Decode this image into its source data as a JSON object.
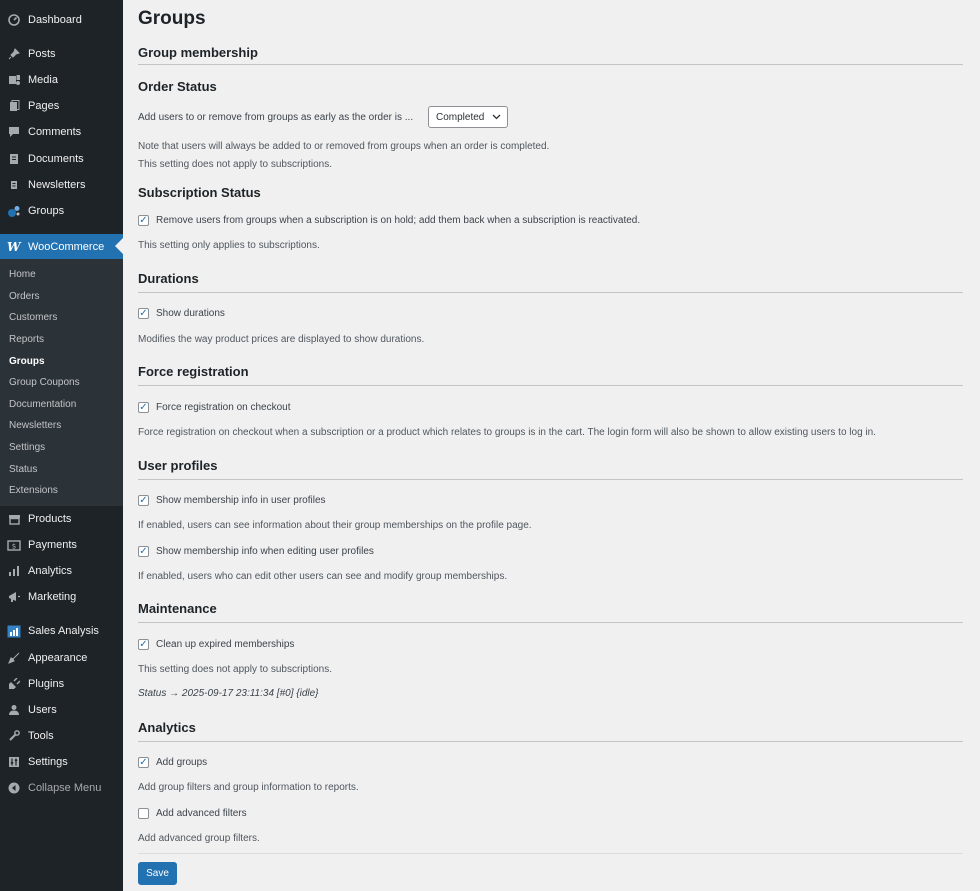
{
  "sidebar": {
    "top_items": [
      {
        "label": "Dashboard",
        "icon": "dashboard-icon"
      },
      {
        "label": "Posts",
        "icon": "pin-icon"
      },
      {
        "label": "Media",
        "icon": "media-icon"
      },
      {
        "label": "Pages",
        "icon": "pages-icon"
      },
      {
        "label": "Comments",
        "icon": "comment-icon"
      },
      {
        "label": "Documents",
        "icon": "documents-icon"
      },
      {
        "label": "Newsletters",
        "icon": "newsletters-icon"
      },
      {
        "label": "Groups",
        "icon": "groups-icon"
      }
    ],
    "woocommerce": {
      "logo": "W",
      "label": "WooCommerce",
      "submenu": [
        "Home",
        "Orders",
        "Customers",
        "Reports",
        "Groups",
        "Group Coupons",
        "Documentation",
        "Newsletters",
        "Settings",
        "Status",
        "Extensions"
      ],
      "current": "Groups"
    },
    "bottom_items": [
      {
        "label": "Products",
        "icon": "products-icon"
      },
      {
        "label": "Payments",
        "icon": "payments-icon"
      },
      {
        "label": "Analytics",
        "icon": "analytics-icon"
      },
      {
        "label": "Marketing",
        "icon": "marketing-icon"
      },
      {
        "label": "Sales Analysis",
        "icon": "sales-analysis-icon"
      },
      {
        "label": "Appearance",
        "icon": "appearance-icon"
      },
      {
        "label": "Plugins",
        "icon": "plugins-icon"
      },
      {
        "label": "Users",
        "icon": "users-icon"
      },
      {
        "label": "Tools",
        "icon": "tools-icon"
      },
      {
        "label": "Settings",
        "icon": "settings-icon"
      },
      {
        "label": "Collapse Menu",
        "icon": "collapse-icon"
      }
    ]
  },
  "page": {
    "title": "Groups",
    "group_membership": "Group membership",
    "order_status": {
      "heading": "Order Status",
      "label": "Add users to or remove from groups as early as the order is ...",
      "select_value": "Completed",
      "note1": "Note that users will always be added to or removed from groups when an order is completed.",
      "note2": "This setting does not apply to subscriptions."
    },
    "subscription_status": {
      "heading": "Subscription Status",
      "checkbox_label": "Remove users from groups when a subscription is on hold; add them back when a subscription is reactivated.",
      "checked": true,
      "desc": "This setting only applies to subscriptions."
    },
    "durations": {
      "heading": "Durations",
      "checkbox_label": "Show durations",
      "checked": true,
      "desc": "Modifies the way product prices are displayed to show durations."
    },
    "force_registration": {
      "heading": "Force registration",
      "checkbox_label": "Force registration on checkout",
      "checked": true,
      "desc": "Force registration on checkout when a subscription or a product which relates to groups is in the cart. The login form will also be shown to allow existing users to log in."
    },
    "user_profiles": {
      "heading": "User profiles",
      "cb1_label": "Show membership info in user profiles",
      "cb1_checked": true,
      "cb1_desc": "If enabled, users can see information about their group memberships on the profile page.",
      "cb2_label": "Show membership info when editing user profiles",
      "cb2_checked": true,
      "cb2_desc": "If enabled, users who can edit other users can see and modify group memberships."
    },
    "maintenance": {
      "heading": "Maintenance",
      "checkbox_label": "Clean up expired memberships",
      "checked": true,
      "desc": "This setting does not apply to subscriptions.",
      "status": "Status → 2025-09-17 23:11:34 [#0] {idle}"
    },
    "analytics": {
      "heading": "Analytics",
      "cb1_label": "Add groups",
      "cb1_checked": true,
      "cb1_desc": "Add group filters and group information to reports.",
      "cb2_label": "Add advanced filters",
      "cb2_checked": false,
      "cb2_desc": "Add advanced group filters."
    },
    "save_label": "Save"
  },
  "colors": {
    "sidebar_bg": "#1d2327",
    "accent": "#2271b1",
    "page_bg": "#f0f0f1"
  }
}
